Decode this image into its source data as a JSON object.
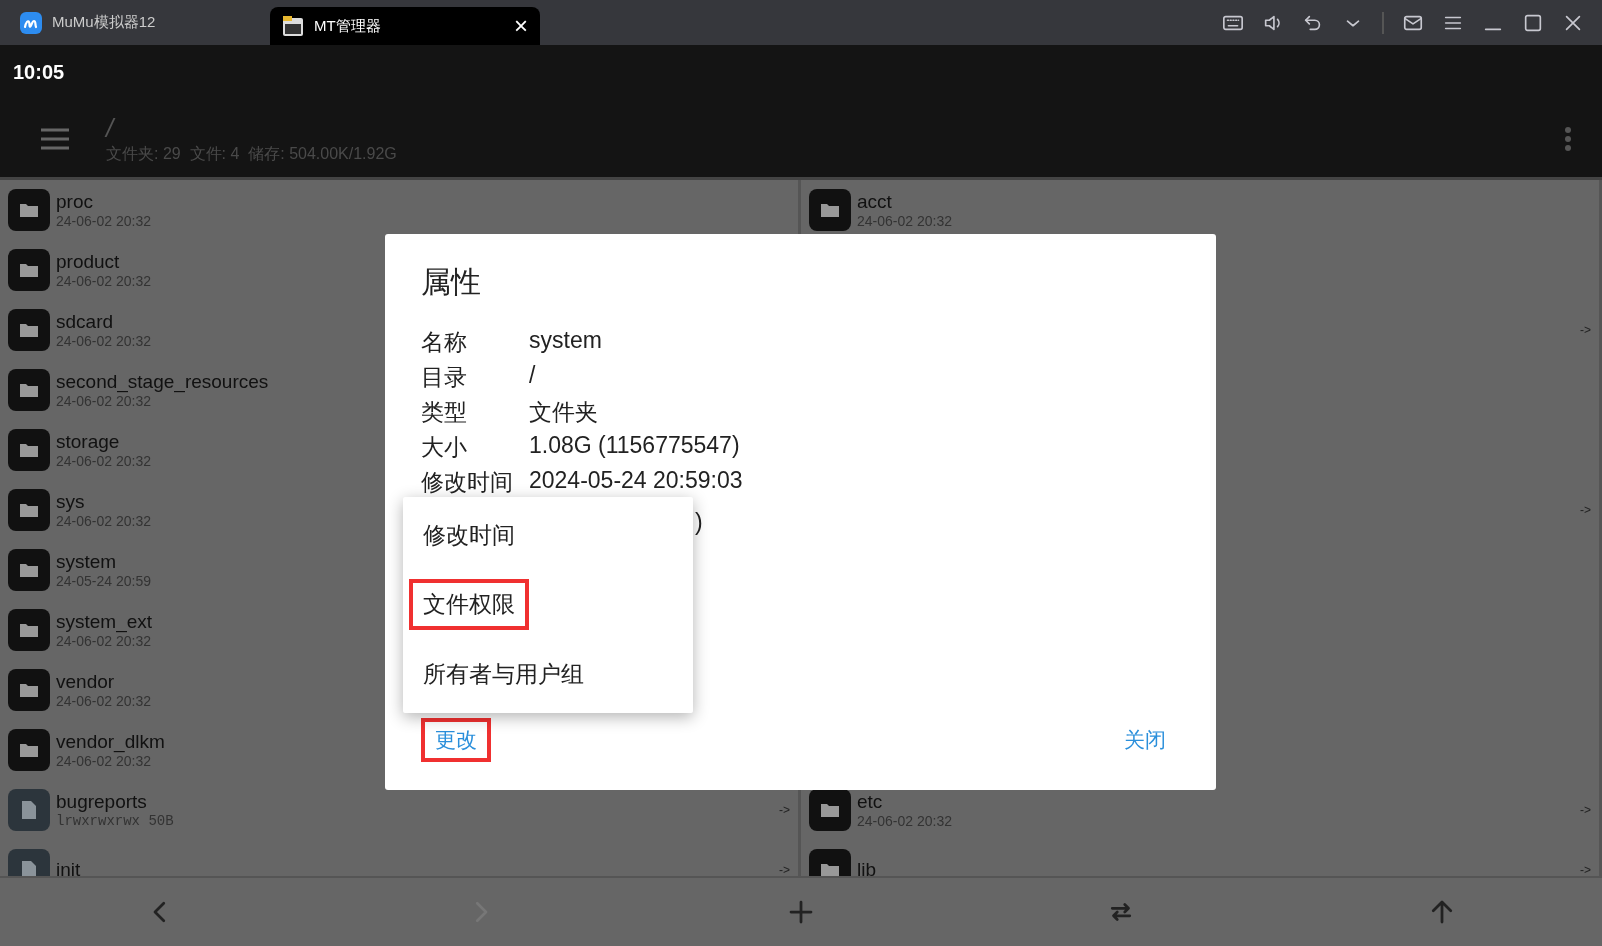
{
  "window": {
    "tabs": [
      {
        "label": "MuMu模拟器12",
        "kind": "mumu",
        "selected": false
      },
      {
        "label": "MT管理器",
        "kind": "mt",
        "selected": true,
        "close": "×"
      }
    ],
    "controls": [
      {
        "kind": "keyboard"
      },
      {
        "kind": "sound"
      },
      {
        "kind": "undo"
      },
      {
        "kind": "chevron"
      },
      {
        "kind": "mail"
      },
      {
        "kind": "menu"
      },
      {
        "kind": "minimize"
      },
      {
        "kind": "maximize"
      },
      {
        "kind": "close"
      }
    ]
  },
  "status_bar": {
    "time": "10:05"
  },
  "toolbar": {
    "path": "/",
    "summary": "文件夹: 29  文件: 4  储存: 504.00K/1.92G"
  },
  "panes": [
    {
      "rows": [
        {
          "kind": "folder",
          "name": "proc",
          "meta": "24-06-02 20:32"
        },
        {
          "kind": "folder",
          "name": "product",
          "meta": "24-06-02 20:32"
        },
        {
          "kind": "folder",
          "name": "sdcard",
          "meta": "24-06-02 20:32"
        },
        {
          "kind": "folder",
          "name": "second_stage_resources",
          "meta": "24-06-02 20:32"
        },
        {
          "kind": "folder",
          "name": "storage",
          "meta": "24-06-02 20:32"
        },
        {
          "kind": "folder",
          "name": "sys",
          "meta": "24-06-02 20:32"
        },
        {
          "kind": "folder",
          "name": "system",
          "meta": "24-05-24 20:59"
        },
        {
          "kind": "folder",
          "name": "system_ext",
          "meta": "24-06-02 20:32"
        },
        {
          "kind": "folder",
          "name": "vendor",
          "meta": "24-06-02 20:32"
        },
        {
          "kind": "folder",
          "name": "vendor_dlkm",
          "meta": "24-06-02 20:32"
        },
        {
          "kind": "file",
          "name": "bugreports",
          "meta": "lrwxrwxrwx 50B",
          "link": "->"
        },
        {
          "kind": "file",
          "name": "init",
          "link": "->"
        }
      ]
    },
    {
      "rows": [
        {
          "kind": "folder",
          "name": "acct",
          "meta": "24-06-02 20:32"
        },
        {
          "kind": "covered"
        },
        {
          "kind": "covered",
          "link": "->"
        },
        {
          "kind": "covered"
        },
        {
          "kind": "covered"
        },
        {
          "kind": "covered",
          "link": "->"
        },
        {
          "kind": "covered"
        },
        {
          "kind": "covered"
        },
        {
          "kind": "covered"
        },
        {
          "kind": "covered"
        },
        {
          "kind": "folder",
          "name": "etc",
          "meta": "24-06-02 20:32",
          "link": "->"
        },
        {
          "kind": "folder",
          "name": "lib",
          "link": "->"
        }
      ]
    }
  ],
  "bottom_bar": [
    {
      "kind": "back",
      "disabled": false
    },
    {
      "kind": "forward",
      "disabled": true
    },
    {
      "kind": "add",
      "disabled": false
    },
    {
      "kind": "swap",
      "disabled": false
    },
    {
      "kind": "up",
      "disabled": false
    }
  ],
  "dialog": {
    "title": "属性",
    "properties": [
      {
        "label": "名称",
        "value": "system"
      },
      {
        "label": "目录",
        "value": "/"
      },
      {
        "label": "类型",
        "value": "文件夹"
      },
      {
        "label": "大小",
        "value": "1.08G (1156775547)"
      },
      {
        "label": "修改时间",
        "value": "2024-05-24 20:59:03"
      }
    ],
    "partial_value": ")",
    "menu": [
      {
        "label": "修改时间",
        "highlighted": false
      },
      {
        "label": "文件权限",
        "highlighted": true
      },
      {
        "label": "所有者与用户组",
        "highlighted": false
      }
    ],
    "buttons": [
      {
        "label": "更改",
        "highlighted": true
      },
      {
        "label": "关闭",
        "highlighted": false
      }
    ]
  }
}
